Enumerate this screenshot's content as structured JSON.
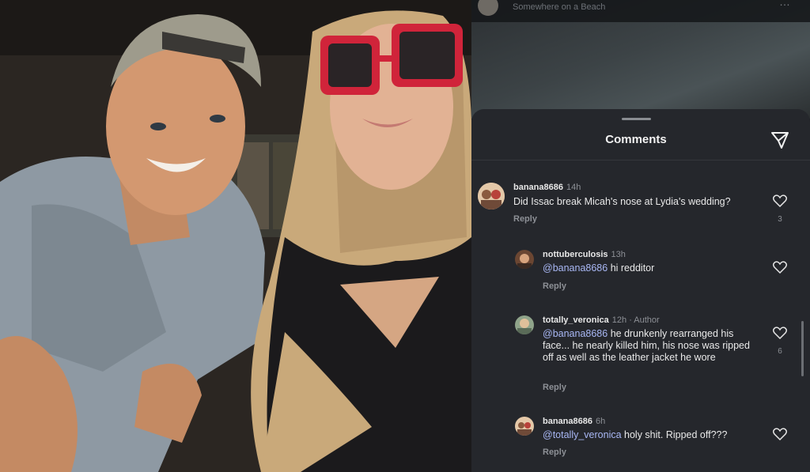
{
  "header": {
    "location": "Somewhere on a Beach",
    "more_label": "…"
  },
  "sheet": {
    "title": "Comments",
    "send_icon": "paper-plane-icon"
  },
  "comments": [
    {
      "username": "banana8686",
      "time": "14h",
      "text": "Did Issac break Micah's nose at Lydia's wedding?",
      "reply_label": "Reply",
      "likes": "3"
    },
    {
      "username": "nottuberculosis",
      "time": "13h",
      "mention": "@banana8686",
      "text": " hi redditor",
      "reply_label": "Reply"
    },
    {
      "username": "totally_veronica",
      "time": "12h",
      "author_badge": "· Author",
      "mention": "@banana8686",
      "text": " he drunkenly rearranged his face... he nearly killed him, his nose was ripped off as well as the leather jacket he wore",
      "reply_label": "Reply",
      "likes": "6"
    },
    {
      "username": "banana8686",
      "time": "6h",
      "mention": "@totally_veronica",
      "text": " holy shit. Ripped off???",
      "reply_label": "Reply"
    }
  ],
  "colors": {
    "panel_bg": "#25272c",
    "mention": "#a9b8f5",
    "muted": "#8d9096",
    "sunglasses": "#d0243a"
  }
}
